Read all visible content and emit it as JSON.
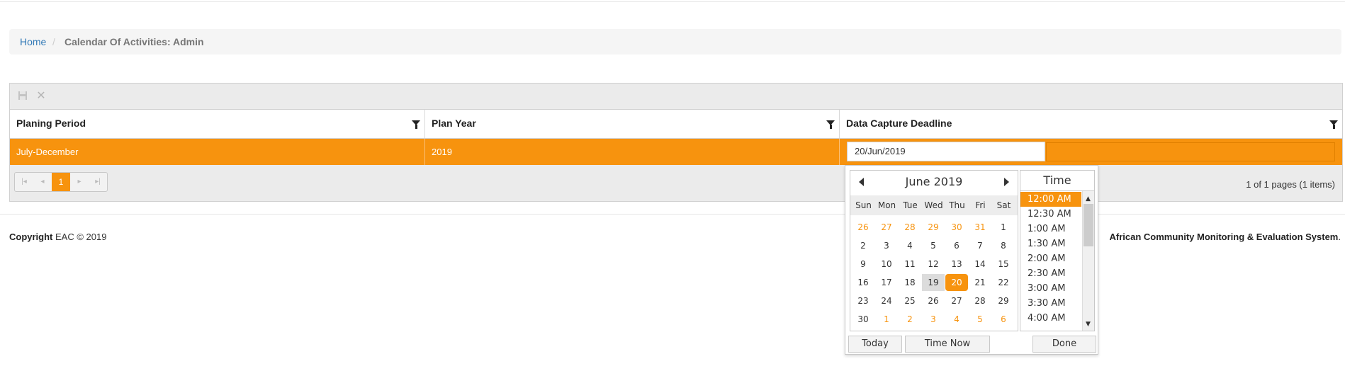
{
  "breadcrumb": {
    "home": "Home",
    "separator": "/",
    "current": "Calendar Of Activities: Admin"
  },
  "toolbar": {
    "save_icon": "save-icon",
    "cancel_icon": "close-icon",
    "cancel_glyph": "✕",
    "save_glyph": "▪"
  },
  "grid": {
    "columns": [
      "Planing Period",
      "Plan Year",
      "Data Capture Deadline"
    ],
    "row": {
      "period": "July-December",
      "year": "2019",
      "deadline": "20/Jun/2019"
    }
  },
  "pager": {
    "current_page": "1",
    "info": "1 of 1 pages (1 items)"
  },
  "footer": {
    "copyright_label": "Copyright",
    "copyright_text": "EAC © 2019",
    "right_text": "African Community Monitoring & Evaluation System",
    "right_suffix": "."
  },
  "calendar": {
    "title": "June 2019",
    "weekdays": [
      "Sun",
      "Mon",
      "Tue",
      "Wed",
      "Thu",
      "Fri",
      "Sat"
    ],
    "weeks": [
      [
        "26",
        "27",
        "28",
        "29",
        "30",
        "31",
        "1"
      ],
      [
        "2",
        "3",
        "4",
        "5",
        "6",
        "7",
        "8"
      ],
      [
        "9",
        "10",
        "11",
        "12",
        "13",
        "14",
        "15"
      ],
      [
        "16",
        "17",
        "18",
        "19",
        "20",
        "21",
        "22"
      ],
      [
        "23",
        "24",
        "25",
        "26",
        "27",
        "28",
        "29"
      ],
      [
        "30",
        "1",
        "2",
        "3",
        "4",
        "5",
        "6"
      ]
    ],
    "selected_day": "20",
    "hover_day": "19"
  },
  "time": {
    "title": "Time",
    "options": [
      "12:00 AM",
      "12:30 AM",
      "1:00 AM",
      "1:30 AM",
      "2:00 AM",
      "2:30 AM",
      "3:00 AM",
      "3:30 AM",
      "4:00 AM"
    ],
    "selected": "12:00 AM"
  },
  "buttons": {
    "today": "Today",
    "time_now": "Time Now",
    "done": "Done"
  },
  "colors": {
    "accent": "#f7930e",
    "link": "#337ab7"
  }
}
